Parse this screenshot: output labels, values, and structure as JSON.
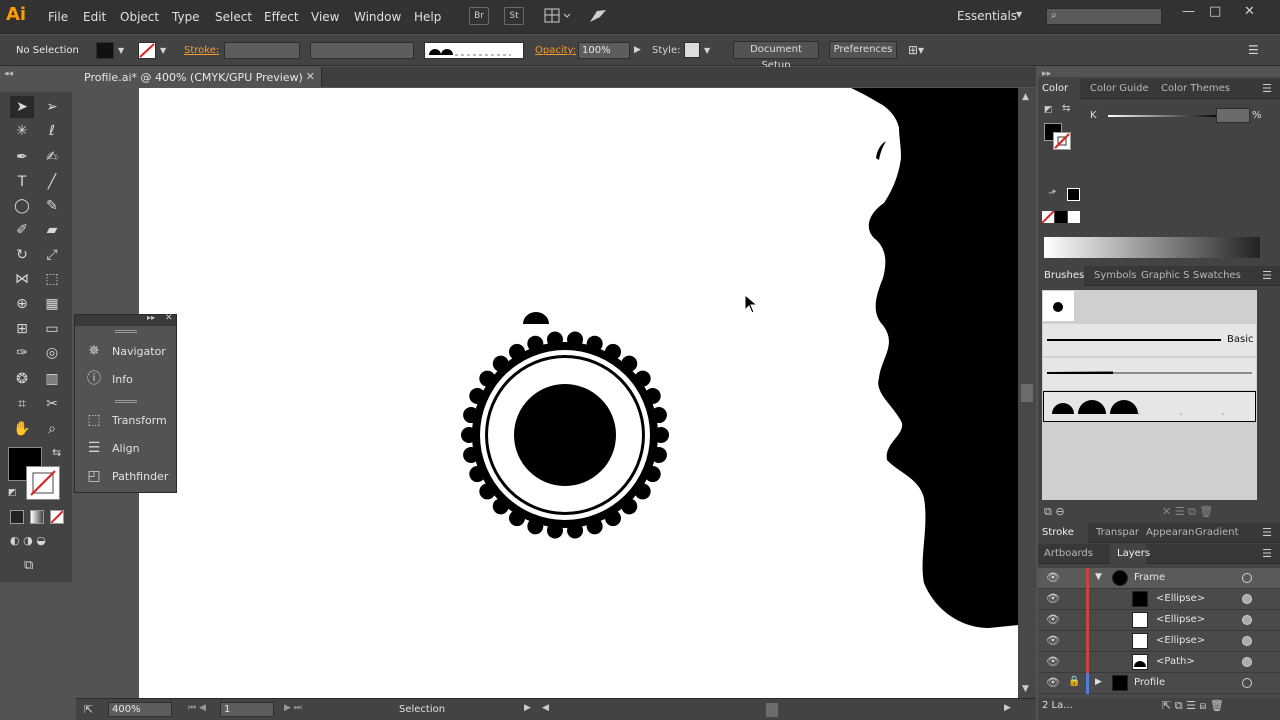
{
  "app": {
    "logo": "Ai",
    "menus": [
      "File",
      "Edit",
      "Object",
      "Type",
      "Select",
      "Effect",
      "View",
      "Window",
      "Help"
    ],
    "bridge_label": "Br",
    "stock_label": "St",
    "workspace": "Essentials",
    "window_controls": [
      "—",
      "□",
      "✕"
    ]
  },
  "controlbar": {
    "selection_status": "No Selection",
    "stroke_label": "Stroke:",
    "opacity_label": "Opacity:",
    "opacity_value": "100%",
    "style_label": "Style:",
    "document_setup": "Document Setup",
    "preferences": "Preferences"
  },
  "document": {
    "tab_title": "Profile.ai* @ 400% (CMYK/GPU Preview)",
    "close": "✕"
  },
  "floating_panel": {
    "items": [
      {
        "label": "Navigator",
        "icon": "navigator-icon",
        "glyph": "✵"
      },
      {
        "label": "Info",
        "icon": "info-icon",
        "glyph": "ⓘ"
      },
      {
        "label": "Transform",
        "icon": "transform-icon",
        "glyph": "⬚"
      },
      {
        "label": "Align",
        "icon": "align-icon",
        "glyph": "☰"
      },
      {
        "label": "Pathfinder",
        "icon": "pathfinder-icon",
        "glyph": "◰"
      }
    ]
  },
  "status": {
    "zoom": "400%",
    "artboard": "1",
    "tool": "Selection"
  },
  "color_panel": {
    "tabs": [
      "Color",
      "Color Guide",
      "Color Themes"
    ],
    "channel_label": "K",
    "percent": "%"
  },
  "brushes_panel": {
    "tabs": [
      "Brushes",
      "Symbols",
      "Graphic S",
      "Swatches"
    ],
    "basic_label": "Basic"
  },
  "stroke_panel": {
    "tabs": [
      "Stroke",
      "Transpar",
      "Appearan",
      "Gradient"
    ]
  },
  "layers_panel": {
    "tabs": [
      "Artboards",
      "Layers"
    ],
    "rows": [
      {
        "name": "Frame",
        "indent": 1
      },
      {
        "name": "<Ellipse>",
        "indent": 2
      },
      {
        "name": "<Ellipse>",
        "indent": 2
      },
      {
        "name": "<Ellipse>",
        "indent": 2
      },
      {
        "name": "<Path>",
        "indent": 2
      },
      {
        "name": "Profile",
        "indent": 1
      }
    ],
    "footer": "2 La..."
  }
}
